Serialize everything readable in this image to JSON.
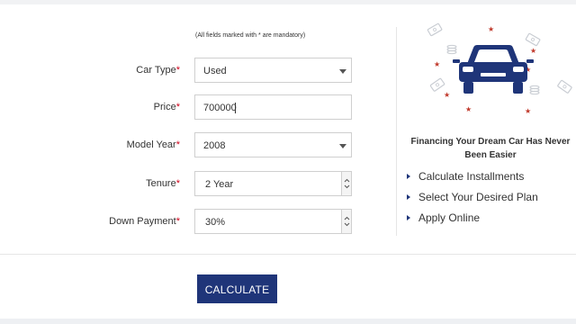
{
  "form": {
    "note": "(All fields marked with * are mandatory)",
    "required_mark": "*",
    "car_type": {
      "label": "Car Type",
      "value": "Used"
    },
    "price": {
      "label": "Price",
      "value": "700000"
    },
    "model_year": {
      "label": "Model Year",
      "value": "2008"
    },
    "tenure": {
      "label": "Tenure",
      "value": "2 Year"
    },
    "down_payment": {
      "label": "Down Payment",
      "value": "30%"
    },
    "calculate_label": "CALCULATE"
  },
  "promo": {
    "title": "Financing Your Dream Car Has Never Been Easier",
    "features": [
      "Calculate Installments",
      "Select Your Desired Plan",
      "Apply Online"
    ]
  },
  "icons": [
    "car-icon",
    "star-icon",
    "banknote-icon",
    "coin-stack-icon",
    "dropdown-caret-icon",
    "spinner-icon",
    "bullet-triangle-icon"
  ],
  "colors": {
    "accent": "#1f3579",
    "required": "#d0021b",
    "star": "#c0392b"
  }
}
